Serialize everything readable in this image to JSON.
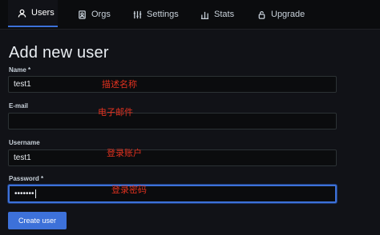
{
  "tabs": [
    {
      "label": "Users",
      "icon": "user-icon",
      "active": true
    },
    {
      "label": "Orgs",
      "icon": "orgs-icon"
    },
    {
      "label": "Settings",
      "icon": "sliders-icon"
    },
    {
      "label": "Stats",
      "icon": "bar-chart-icon"
    },
    {
      "label": "Upgrade",
      "icon": "lock-icon"
    }
  ],
  "page": {
    "title": "Add new user"
  },
  "form": {
    "name": {
      "label": "Name *",
      "value": "test1",
      "annotation": "描述名称"
    },
    "email": {
      "label": "E-mail",
      "value": "",
      "annotation": "电子邮件"
    },
    "username": {
      "label": "Username",
      "value": "test1",
      "annotation": "登录账户"
    },
    "password": {
      "label": "Password *",
      "value": "•••••••",
      "annotation": "登录密码"
    }
  },
  "buttons": {
    "create": "Create user"
  },
  "colors": {
    "accent": "#3d71d9",
    "annotation": "#e0311f",
    "background": "#111217"
  }
}
